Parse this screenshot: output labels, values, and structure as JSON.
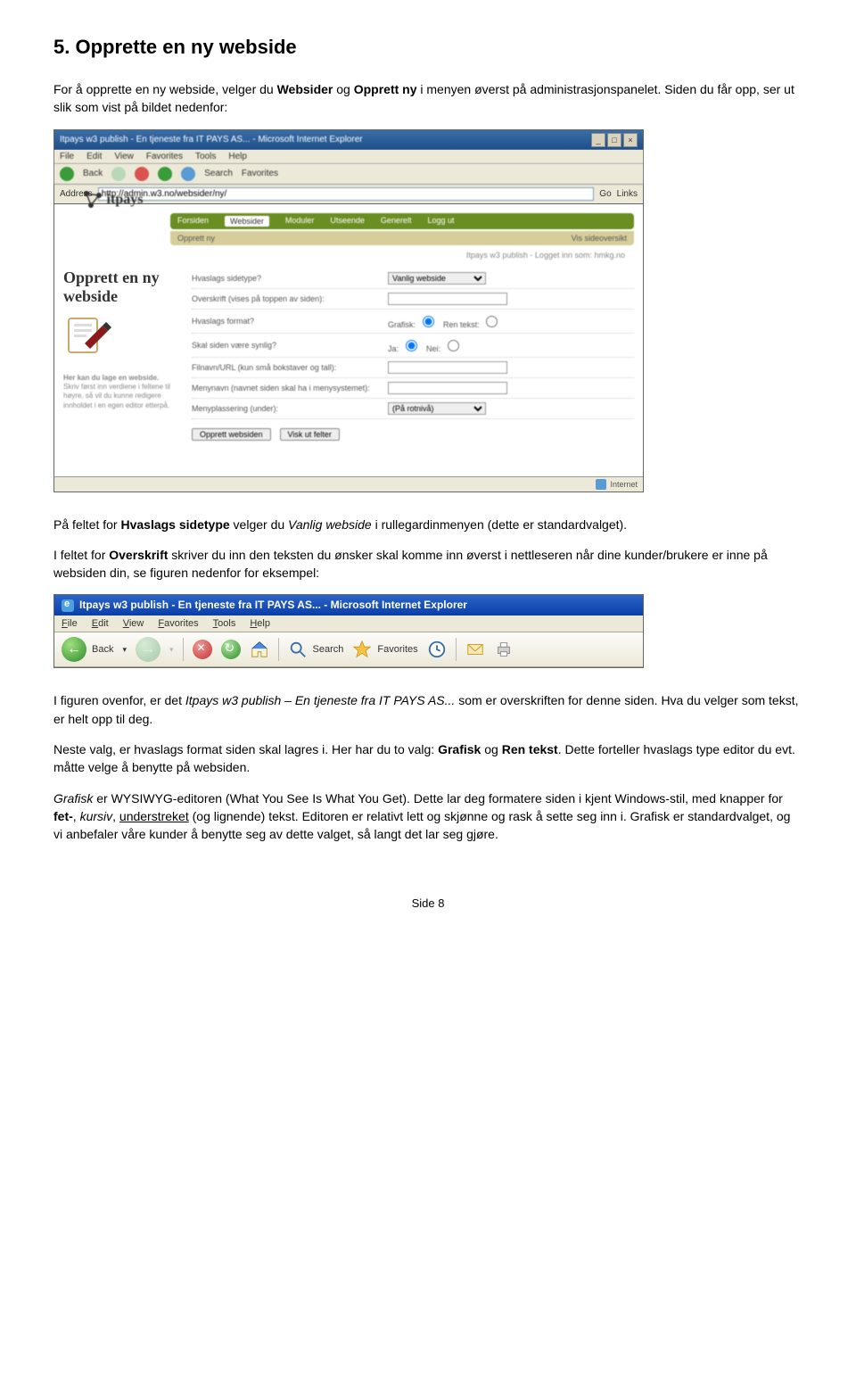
{
  "heading": "5. Opprette en ny webside",
  "intro_1a": "For å opprette en ny webside, velger du ",
  "intro_1_bold1": "Websider",
  "intro_1b": " og ",
  "intro_1_bold2": "Opprett ny",
  "intro_1c": " i menyen øverst på administrasjonspanelet. Siden du får opp, ser ut slik som vist på bildet nedenfor:",
  "shot1": {
    "title": "Itpays w3 publish - En tjeneste fra IT PAYS AS... - Microsoft Internet Explorer",
    "menu": [
      "File",
      "Edit",
      "View",
      "Favorites",
      "Tools",
      "Help"
    ],
    "toolbar": [
      "Back",
      "",
      "",
      "",
      "",
      "Search",
      "Favorites"
    ],
    "address_label": "Address",
    "address_value": "http://admin.w3.no/websider/ny/",
    "go": "Go",
    "links": "Links",
    "nav": [
      "Forsiden",
      "Websider",
      "Moduler",
      "Utseende",
      "Generelt",
      "Logg ut"
    ],
    "subnav_left": "Opprett ny",
    "subnav_right": "Vis sideoversikt",
    "loggedin": "Itpays w3 publish - Logget inn som: hmkg.no",
    "panel_title": "Opprett en ny webside",
    "rows": [
      {
        "label": "Hvaslags sidetype?",
        "type": "select",
        "val": "Vanlig webside"
      },
      {
        "label": "Overskrift (vises på toppen av siden):",
        "type": "text",
        "val": ""
      },
      {
        "label": "Hvaslags format?",
        "type": "radio",
        "opts": [
          "Grafisk:",
          "Ren tekst:"
        ]
      },
      {
        "label": "Skal siden være synlig?",
        "type": "radio",
        "opts": [
          "Ja:",
          "Nei:"
        ]
      },
      {
        "label": "Filnavn/URL (kun små bokstaver og tall):",
        "type": "text",
        "val": ""
      },
      {
        "label": "Menynavn (navnet siden skal ha i menysystemet):",
        "type": "text",
        "val": ""
      },
      {
        "label": "Menyplassering (under):",
        "type": "select",
        "val": "(På rotnivå)"
      }
    ],
    "hint_title": "Her kan du lage en webside.",
    "hint_body": "Skriv først inn verdiene i feltene til høyre, så vil du kunne redigere innholdet i en egen editor etterpå.",
    "btn1": "Opprett websiden",
    "btn2": "Visk ut felter",
    "status": "Internet"
  },
  "para2a": "På feltet for ",
  "para2_bold": "Hvaslags sidetype",
  "para2b": " velger du ",
  "para2_italic": "Vanlig webside",
  "para2c": " i rullegardinmenyen (dette er standardvalget).",
  "para3a": "I feltet for ",
  "para3_bold": "Overskrift",
  "para3b": " skriver du inn den teksten du ønsker skal komme inn øverst i nettleseren når dine kunder/brukere er inne på websiden din, se figuren nedenfor for eksempel:",
  "shot2": {
    "title": "Itpays w3 publish - En tjeneste fra IT PAYS AS... - Microsoft Internet Explorer",
    "menu": [
      "File",
      "Edit",
      "View",
      "Favorites",
      "Tools",
      "Help"
    ],
    "back": "Back",
    "search": "Search",
    "favorites": "Favorites"
  },
  "para4a": "I figuren ovenfor, er det ",
  "para4_italic": "Itpays w3 publish – En tjeneste fra IT PAYS AS...",
  "para4b": "  som er overskriften for denne siden. Hva du velger som tekst, er helt opp til deg.",
  "para5a": "Neste valg, er hvaslags format siden skal lagres i. Her har du to valg: ",
  "para5_bold1": "Grafisk",
  "para5b": " og ",
  "para5_bold2": "Ren tekst",
  "para5c": ". Dette forteller hvaslags type editor du evt. måtte velge å benytte på websiden.",
  "para6a_italic": "Grafisk",
  "para6a": " er WYSIWYG-editoren (What You See Is What You Get). Dette lar deg formatere siden i kjent Windows-stil, med knapper for ",
  "para6_bold1": "fet-",
  "para6b": ", ",
  "para6_italic2": "kursiv",
  "para6c": ", ",
  "para6_under": "understreket",
  "para6d": " (og lignende) tekst. Editoren er relativt lett og skjønne og rask å sette seg inn i. Grafisk er standardvalget, og vi anbefaler våre kunder å benytte seg av dette valget, så langt det lar seg gjøre.",
  "footer": "Side 8"
}
